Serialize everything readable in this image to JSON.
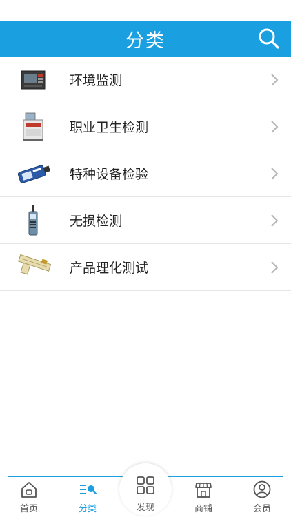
{
  "header": {
    "title": "分类"
  },
  "categories": [
    {
      "label": "环境监测",
      "icon": "monitor-device-icon"
    },
    {
      "label": "职业卫生检测",
      "icon": "lab-instrument-icon"
    },
    {
      "label": "特种设备检验",
      "icon": "handheld-tester-icon"
    },
    {
      "label": "无损检测",
      "icon": "sound-meter-icon"
    },
    {
      "label": "产品理化测试",
      "icon": "measuring-tool-icon"
    }
  ],
  "tabbar": {
    "home": "首页",
    "category": "分类",
    "discover": "发现",
    "shops": "商铺",
    "member": "会员"
  },
  "colors": {
    "accent": "#1a9fe0"
  }
}
